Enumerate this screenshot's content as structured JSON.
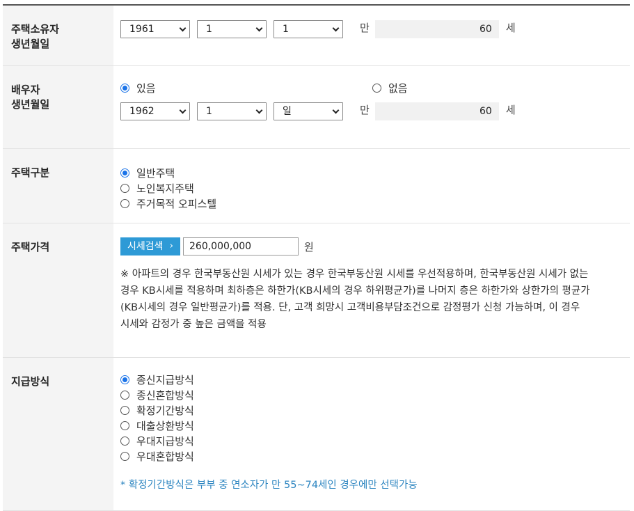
{
  "owner": {
    "label_line1": "주택소유자",
    "label_line2": "생년월일",
    "year": "1961",
    "month": "1",
    "day": "1",
    "man_label": "만",
    "age": "60",
    "age_unit": "세"
  },
  "spouse": {
    "label_line1": "배우자",
    "label_line2": "생년월일",
    "option_yes": "있음",
    "option_no": "없음",
    "selected": "yes",
    "year": "1962",
    "month": "1",
    "day": "일",
    "man_label": "만",
    "age": "60",
    "age_unit": "세"
  },
  "house_type": {
    "label": "주택구분",
    "options": [
      "일반주택",
      "노인복지주택",
      "주거목적 오피스텔"
    ],
    "selected_index": 0
  },
  "house_price": {
    "label": "주택가격",
    "search_button": "시세검색",
    "search_button_arrow": "›",
    "value": "260,000,000",
    "unit": "원",
    "note_lines": [
      "※ 아파트의 경우 한국부동산원 시세가 있는 경우 한국부동산원 시세를 우선적용하며, 한국부동산원 시세가 없는",
      "경우 KB시세를 적용하며 최하층은 하한가(KB시세의 경우 하위평균가)를 나머지 층은 하한가와 상한가의 평균가",
      "(KB시세의 경우 일반평균가)를 적용. 단, 고객 희망시 고객비용부담조건으로 감정평가 신청 가능하며, 이 경우",
      "시세와 감정가 중 높은 금액을 적용"
    ]
  },
  "payment": {
    "label": "지급방식",
    "options": [
      "종신지급방식",
      "종신혼합방식",
      "확정기간방식",
      "대출상환방식",
      "우대지급방식",
      "우대혼합방식"
    ],
    "selected_index": 0,
    "note": "* 확정기간방식은 부부 중 연소자가 만 55~74세인 경우에만 선택가능"
  },
  "colors": {
    "accent": "#1a73e8",
    "button": "#2e9ad6",
    "note_blue": "#2e86c1"
  }
}
